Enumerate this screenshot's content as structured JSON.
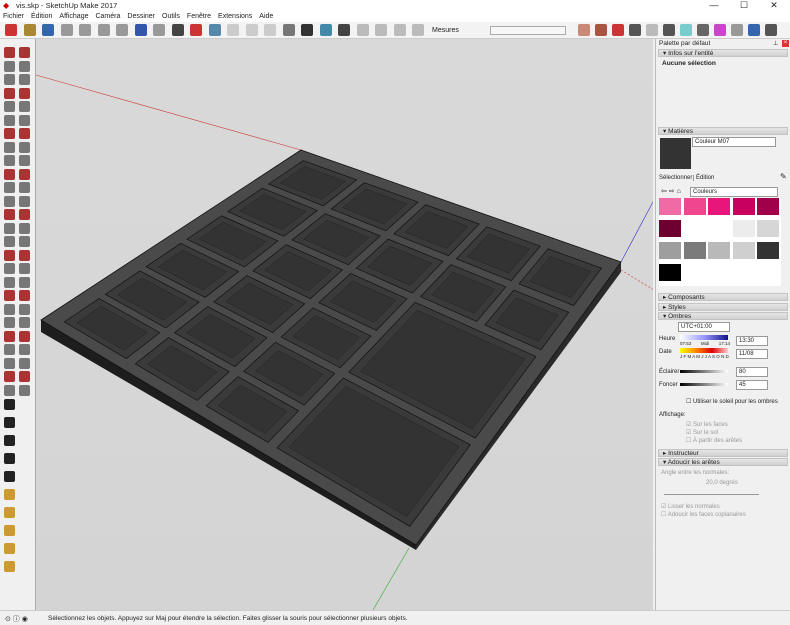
{
  "window": {
    "title": "vis.skp - SketchUp Make 2017",
    "min": "—",
    "max": "☐",
    "close": "✕"
  },
  "menu": [
    "Fichier",
    "Édition",
    "Affichage",
    "Caméra",
    "Dessiner",
    "Outils",
    "Fenêtre",
    "Extensions",
    "Aide"
  ],
  "toolbar": {
    "mesures_label": "Mesures",
    "mesures_value": ""
  },
  "panel": {
    "title": "Palette par défaut",
    "entity": {
      "header": "Infos sur l'entité",
      "value": "Aucune sélection"
    },
    "materials": {
      "header": "Matières",
      "name": "Couleur M07",
      "tab_select": "Sélectionner",
      "tab_edit": "Édition",
      "library": "Couleurs",
      "swatch_color": "#333333",
      "swatches": [
        "#f06aa6",
        "#f0458f",
        "#e8167a",
        "#c8005e",
        "#a0004a",
        "#6d0030",
        "#ffffff",
        "#ffffff",
        "#ececec",
        "#d6d6d6",
        "#9e9e9e",
        "#7b7b7b",
        "#b9b9b9",
        "#cfcfcf",
        "#333333",
        "#000000"
      ]
    },
    "components": "Composants",
    "styles": "Styles",
    "shadows": {
      "header": "Ombres",
      "timezone": "UTC+01:00",
      "heure_label": "Heure",
      "time_start": "07:53",
      "time_mid": "Midi",
      "time_end": "17:14",
      "time_value": "13:30",
      "date_label": "Date",
      "months": "J F M A M J J A S O N D",
      "date_value": "11/08",
      "light_label": "Éclairer",
      "light_value": "80",
      "dark_label": "Foncer",
      "dark_value": "45",
      "sun_label": "Utiliser le soleil pour les ombres",
      "display_label": "Affichage:",
      "on_faces": "Sur les faces",
      "on_ground": "Sur le sol",
      "from_edges": "À partir des arêtes"
    },
    "instructor": "Instructeur",
    "soften": {
      "header": "Adoucir les arêtes",
      "angle_label": "Angle entre les normales:",
      "angle_value": "20,0  degrés",
      "smooth": "Lisser les normales",
      "coplanar": "Adoucir les faces coplanaires"
    }
  },
  "status": {
    "message": "Sélectionnez les objets. Appuyez sur Maj pour étendre la sélection. Faites glisser la souris pour sélectionner plusieurs objets."
  }
}
